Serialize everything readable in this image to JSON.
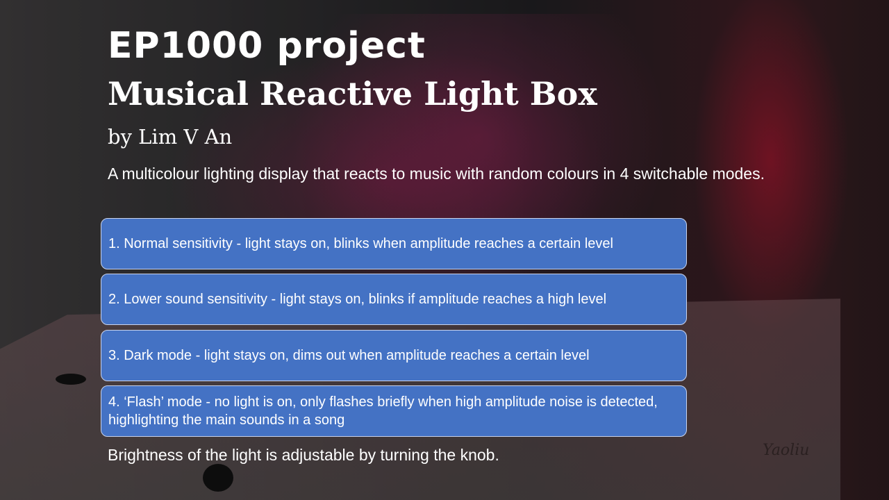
{
  "slide": {
    "title": "EP1000 project",
    "subtitle": "Musical Reactive Light Box",
    "author": "by Lim V An",
    "description": "A multicolour lighting display that reacts to music with random colours in 4 switchable modes.",
    "modes": [
      "1. Normal sensitivity - light stays on, blinks when amplitude reaches a certain level",
      "2. Lower sound sensitivity - light stays on, blinks if amplitude reaches a high level",
      "3. Dark mode - light stays on, dims out when amplitude reaches a certain level",
      "4. ‘Flash’ mode - no light is on, only flashes briefly when high amplitude noise is detected, highlighting the main sounds in a song"
    ],
    "footer": "Brightness of the light is adjustable by turning the knob."
  },
  "background": {
    "signature": "Yaoliu"
  },
  "colors": {
    "mode_box": "#4472c4",
    "glow": "#c8143c"
  }
}
